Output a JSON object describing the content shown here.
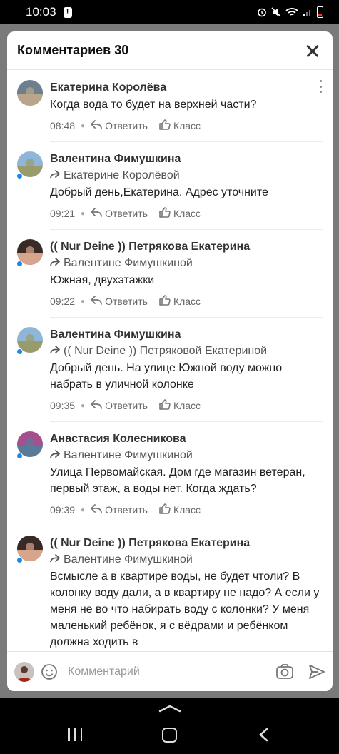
{
  "status": {
    "time": "10:03",
    "alert": "!"
  },
  "sheet": {
    "title": "Комментариев 30"
  },
  "actions": {
    "reply": "Ответить",
    "like": "Класс"
  },
  "comments": [
    {
      "author": "Екатерина Королёва",
      "reply_to": "",
      "text": "Когда вода то будет на верхней части?",
      "time": "08:48",
      "online": false,
      "avatar_colors": [
        "#6d7f8c",
        "#b9a58a"
      ]
    },
    {
      "author": "Валентина Фимушкина",
      "reply_to": "Екатерине Королёвой",
      "text": "Добрый день,Екатерина. Адрес уточните",
      "time": "09:21",
      "online": true,
      "avatar_colors": [
        "#8fb6d8",
        "#9a9b6a"
      ]
    },
    {
      "author": "(( Nur Deine )) Петрякова Екатерина",
      "reply_to": "Валентине Фимушкиной",
      "text": "Южная, двухэтажки",
      "time": "09:22",
      "online": true,
      "avatar_colors": [
        "#3a2a26",
        "#d8a58c"
      ]
    },
    {
      "author": "Валентина Фимушкина",
      "reply_to": "(( Nur Deine )) Петряковой Екатериной",
      "text": "Добрый день. На улице Южной воду можно набрать в уличной колонке",
      "time": "09:35",
      "online": true,
      "avatar_colors": [
        "#8fb6d8",
        "#9a9b6a"
      ]
    },
    {
      "author": "Анастасия Колесникова",
      "reply_to": "Валентине Фимушкиной",
      "text": "Улица Первомайская. Дом где магазин ветеран, первый этаж, а воды нет. Когда ждать?",
      "time": "09:39",
      "online": true,
      "avatar_colors": [
        "#a64f8f",
        "#5a7a9a"
      ]
    },
    {
      "author": "(( Nur Deine )) Петрякова Екатерина",
      "reply_to": "Валентине Фимушкиной",
      "text": "Всмысле а в квартире воды, не будет чтоли? В колонку воду дали, а в квартиру не надо? А если у меня не во что набирать воду с колонки? У меня маленький ребёнок, я с вёдрами и ребёнком должна ходить в",
      "time": "",
      "online": true,
      "avatar_colors": [
        "#3a2a26",
        "#d8a58c"
      ]
    }
  ],
  "composer": {
    "placeholder": "Комментарий"
  }
}
